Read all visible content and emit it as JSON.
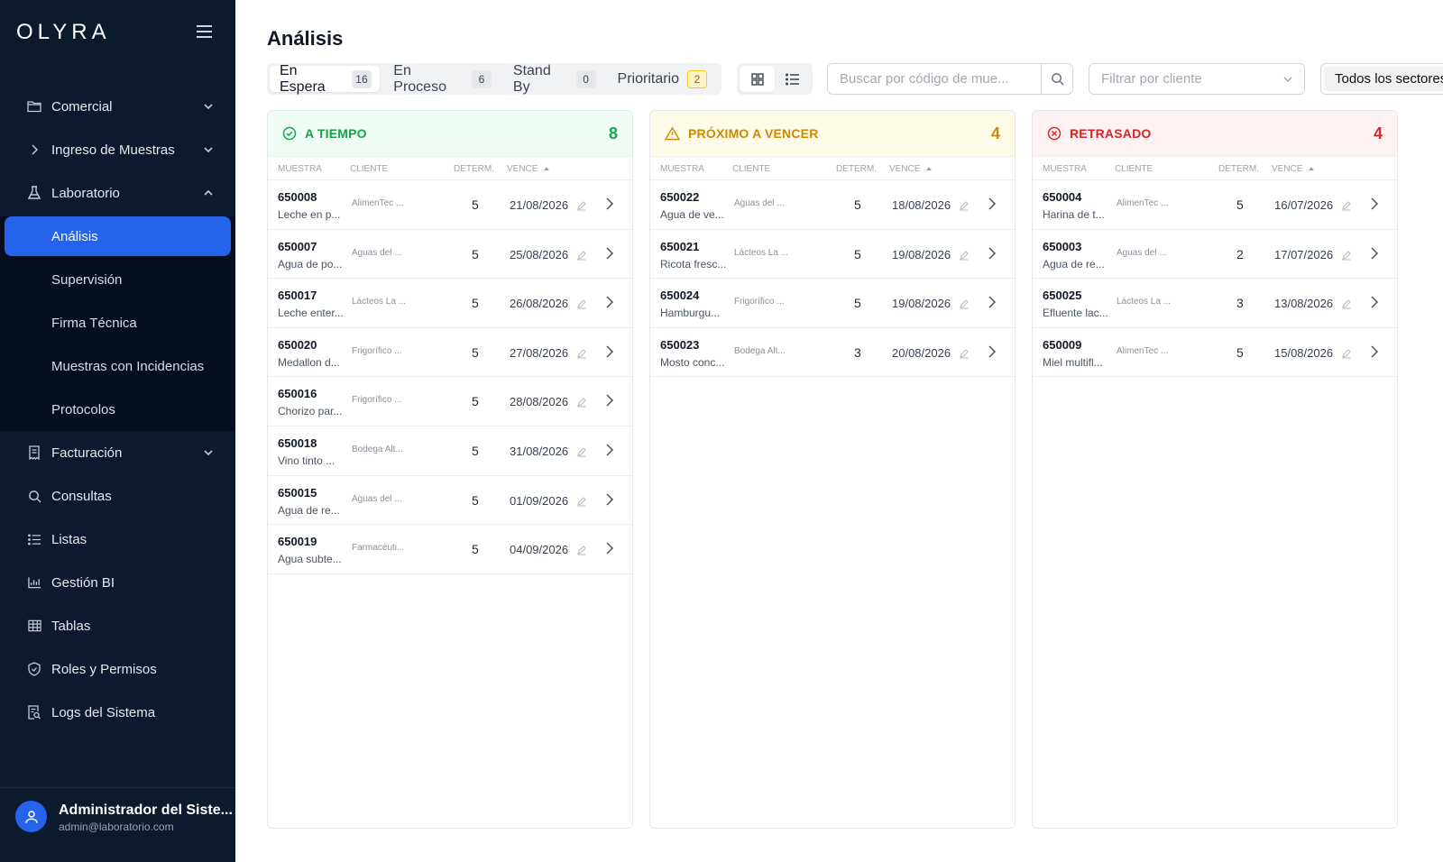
{
  "app": {
    "logo": "OLYRA"
  },
  "sidebar": {
    "items": [
      {
        "label": "Comercial",
        "icon": "folder-icon",
        "chevron": "down"
      },
      {
        "label": "Ingreso de Muestras",
        "icon": "chevron-right-icon",
        "chevron": "down"
      },
      {
        "label": "Laboratorio",
        "icon": "flask-icon",
        "chevron": "up"
      }
    ],
    "sub_items": [
      {
        "label": "Análisis",
        "active": true
      },
      {
        "label": "Supervisión"
      },
      {
        "label": "Firma Técnica"
      },
      {
        "label": "Muestras con Incidencias"
      },
      {
        "label": "Protocolos"
      }
    ],
    "items_after": [
      {
        "label": "Facturación",
        "icon": "receipt-icon",
        "chevron": "down"
      },
      {
        "label": "Consultas",
        "icon": "search-icon"
      },
      {
        "label": "Listas",
        "icon": "list-icon"
      },
      {
        "label": "Gestión BI",
        "icon": "bar-chart-icon"
      },
      {
        "label": "Tablas",
        "icon": "table-icon"
      },
      {
        "label": "Roles y Permisos",
        "icon": "shield-icon"
      },
      {
        "label": "Logs del Sistema",
        "icon": "log-search-icon"
      }
    ],
    "user": {
      "name": "Administrador del Siste...",
      "email": "admin@laboratorio.com"
    }
  },
  "main": {
    "title": "Análisis",
    "tabs": [
      {
        "label": "En Espera",
        "count": "16",
        "active": true
      },
      {
        "label": "En Proceso",
        "count": "6"
      },
      {
        "label": "Stand By",
        "count": "0"
      },
      {
        "label": "Prioritario",
        "count": "2",
        "warn": true
      }
    ],
    "search": {
      "placeholder": "Buscar por código de mue..."
    },
    "client_filter": {
      "placeholder": "Filtrar por cliente"
    },
    "sector_filter": {
      "value": "Todos los sectores"
    }
  },
  "table_headers": {
    "muestra": "MUESTRA",
    "cliente": "CLIENTE",
    "determ": "DETERM.",
    "vence": "VENCE"
  },
  "columns": [
    {
      "title": "A TIEMPO",
      "count": "8",
      "icon": "check-circle-icon",
      "color": "#16a34a",
      "bg": "#f0fdf4",
      "rows": [
        {
          "id": "650008",
          "desc": "Leche en p...",
          "client": "AlimenTec ...",
          "det": "5",
          "due": "21/08/2026"
        },
        {
          "id": "650007",
          "desc": "Agua de po...",
          "client": "Aguas del ...",
          "det": "5",
          "due": "25/08/2026"
        },
        {
          "id": "650017",
          "desc": "Leche enter...",
          "client": "Lácteos La ...",
          "det": "5",
          "due": "26/08/2026"
        },
        {
          "id": "650020",
          "desc": "Medallon d...",
          "client": "Frigorífico ...",
          "det": "5",
          "due": "27/08/2026"
        },
        {
          "id": "650016",
          "desc": "Chorizo par...",
          "client": "Frigorífico ...",
          "det": "5",
          "due": "28/08/2026"
        },
        {
          "id": "650018",
          "desc": "Vino tinto ...",
          "client": "Bodega Alt...",
          "det": "5",
          "due": "31/08/2026"
        },
        {
          "id": "650015",
          "desc": "Agua de re...",
          "client": "Aguas del ...",
          "det": "5",
          "due": "01/09/2026"
        },
        {
          "id": "650019",
          "desc": "Agua subte...",
          "client": "Farmacéuti...",
          "det": "5",
          "due": "04/09/2026"
        }
      ]
    },
    {
      "title": "PRÓXIMO A VENCER",
      "count": "4",
      "icon": "warning-triangle-icon",
      "color": "#ca8a04",
      "bg": "#fefce8",
      "rows": [
        {
          "id": "650022",
          "desc": "Agua de ve...",
          "client": "Aguas del ...",
          "det": "5",
          "due": "18/08/2026"
        },
        {
          "id": "650021",
          "desc": "Ricota fresc...",
          "client": "Lácteos La ...",
          "det": "5",
          "due": "19/08/2026"
        },
        {
          "id": "650024",
          "desc": "Hamburgu...",
          "client": "Frigorífico ...",
          "det": "5",
          "due": "19/08/2026"
        },
        {
          "id": "650023",
          "desc": "Mosto conc...",
          "client": "Bodega Alt...",
          "det": "3",
          "due": "20/08/2026"
        }
      ]
    },
    {
      "title": "RETRASADO",
      "count": "4",
      "icon": "x-circle-icon",
      "color": "#dc2626",
      "bg": "#fef2f2",
      "rows": [
        {
          "id": "650004",
          "desc": "Harina de t...",
          "client": "AlimenTec ...",
          "det": "5",
          "due": "16/07/2026"
        },
        {
          "id": "650003",
          "desc": "Agua de re...",
          "client": "Aguas del ...",
          "det": "2",
          "due": "17/07/2026"
        },
        {
          "id": "650025",
          "desc": "Efluente lac...",
          "client": "Lácteos La ...",
          "det": "3",
          "due": "13/08/2026"
        },
        {
          "id": "650009",
          "desc": "Miel multifl...",
          "client": "AlimenTec ...",
          "det": "5",
          "due": "15/08/2026"
        }
      ]
    }
  ]
}
